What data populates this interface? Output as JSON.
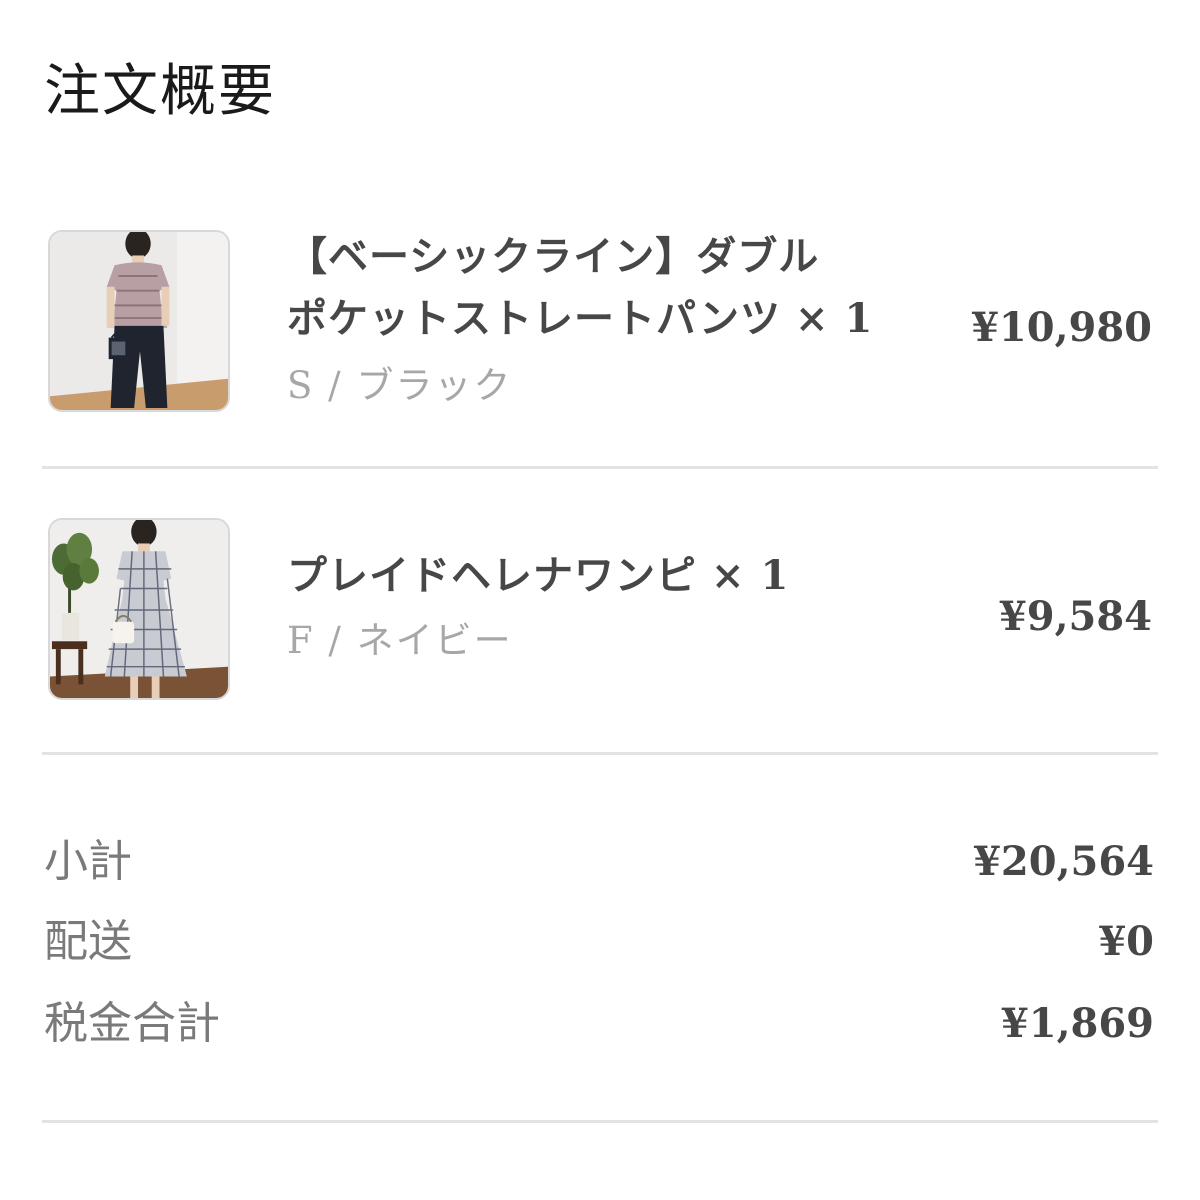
{
  "title": "注文概要",
  "items": [
    {
      "name_line1": "【ベーシックライン】ダブル",
      "name_line2": "ポケットストレートパンツ",
      "quantity": "× 1",
      "variant": "S / ブラック",
      "price": "¥10,980"
    },
    {
      "name_line1": "プレイドヘレナワンピ",
      "quantity": "× 1",
      "variant": "F / ネイビー",
      "price": "¥9,584"
    }
  ],
  "summary": {
    "subtotal_label": "小計",
    "subtotal_value": "¥20,564",
    "shipping_label": "配送",
    "shipping_value": "¥0",
    "tax_label": "税金合計",
    "tax_value": "¥1,869"
  }
}
